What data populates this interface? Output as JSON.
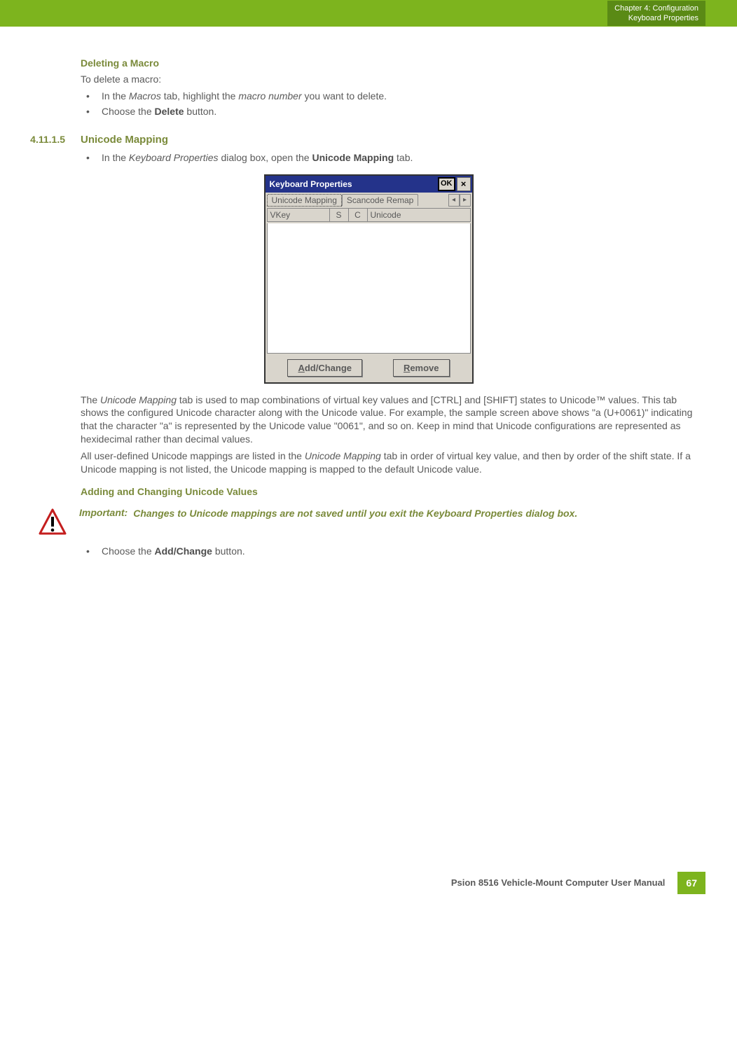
{
  "header": {
    "chapter": "Chapter 4:  Configuration",
    "section": "Keyboard Properties"
  },
  "del_macro_heading": "Deleting a Macro",
  "del_macro_intro": "To delete a macro:",
  "del_bullets": {
    "b1_pre": "In the ",
    "b1_it1": "Macros",
    "b1_mid": " tab, highlight the ",
    "b1_it2": "macro number",
    "b1_post": " you want to delete.",
    "b2_pre": "Choose the ",
    "b2_bold": "Delete",
    "b2_post": " button."
  },
  "sec_num": "4.11.1.5",
  "sec_title": "Unicode Mapping",
  "sec_bullet": {
    "pre": "In the ",
    "it": "Keyboard Properties",
    "mid": " dialog box, open the ",
    "bold": "Unicode Mapping",
    "post": " tab."
  },
  "dialog": {
    "title": "Keyboard Properties",
    "ok": "OK",
    "tab1": "Unicode Mapping",
    "tab2": "Scancode Remap",
    "col_vkey": "VKey",
    "col_s": "S",
    "col_c": "C",
    "col_unicode": "Unicode",
    "btn_add_u": "A",
    "btn_add_rest": "dd/Change",
    "btn_rem_u": "R",
    "btn_rem_rest": "emove"
  },
  "para1": {
    "p1": "The ",
    "it1": "Unicode Mapping",
    "p2": " tab is used to map combinations of virtual key values and [CTRL] and [SHIFT] states to Unicode™ values. This tab shows the configured Unicode character along with the Unicode value. For example, the sample screen above shows \"a (U+0061)\" indicating that the character \"a\" is represented by the Unicode value \"0061\", and so on. Keep in mind that Unicode configurations are represented as hexidecimal rather than decimal values."
  },
  "para2": {
    "p1": "All user-defined Unicode mappings are listed in the ",
    "it1": "Unicode Mapping",
    "p2": " tab in order of virtual key value, and then by order of the shift state. If a Unicode mapping is not listed, the Unicode mapping is mapped to the default Unicode value."
  },
  "add_heading": "Adding and Changing Unicode Values",
  "important": {
    "label": "Important:",
    "text": "Changes to Unicode mappings are not saved until you exit the Keyboard Properties dialog box."
  },
  "add_bullet": {
    "pre": "Choose the ",
    "bold": "Add/Change",
    "post": " button."
  },
  "footer": {
    "text": "Psion 8516 Vehicle-Mount Computer User Manual",
    "page": "67"
  }
}
